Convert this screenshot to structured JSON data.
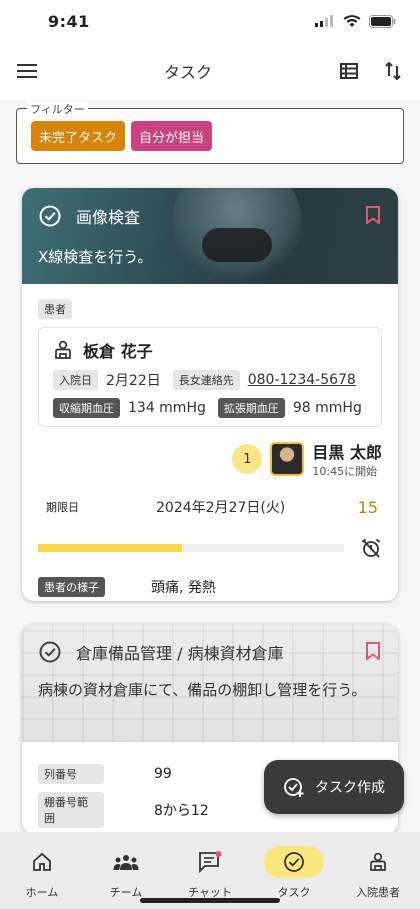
{
  "status": {
    "time": "9:41"
  },
  "header": {
    "title": "タスク"
  },
  "filter": {
    "label": "フィルター",
    "chips": [
      {
        "label": "未完了タスク",
        "color": "#d7840a"
      },
      {
        "label": "自分が担当",
        "color": "#c7427e"
      }
    ]
  },
  "task1": {
    "title": "画像検査",
    "description": "X線検査を行う。",
    "patient_tag": "患者",
    "patient_name": "板倉 花子",
    "admission_label": "入院日",
    "admission_date": "2月22日",
    "contact_label": "長女連絡先",
    "contact_phone": "080-1234-5678",
    "systolic_label": "収縮期血圧",
    "systolic_value": "134 mmHg",
    "diastolic_label": "拡張期血圧",
    "diastolic_value": "98 mmHg",
    "assignee_count": "1",
    "assignee_name": "目黒 太郎",
    "assignee_start": "10:45に開始",
    "due_label": "期限日",
    "due_date": "2024年2月27日(火)",
    "due_days": "15",
    "progress": 0.47,
    "condition_label": "患者の様子",
    "condition_value": "頭痛, 発熱"
  },
  "task2": {
    "title": "倉庫備品管理 / 病棟資材倉庫",
    "description": "病棟の資材倉庫にて、備品の棚卸し管理を行う。",
    "row_label": "列番号",
    "row_value": "99",
    "shelf_label": "棚番号範囲",
    "shelf_value": "8から12"
  },
  "fab": {
    "label": "タスク作成"
  },
  "nav": {
    "home": "ホーム",
    "team": "チーム",
    "chat": "チャット",
    "task": "タスク",
    "patients": "入院患者"
  },
  "colors": {
    "accent_yellow": "#fbe680",
    "bookmark_red": "#e05a6a"
  }
}
